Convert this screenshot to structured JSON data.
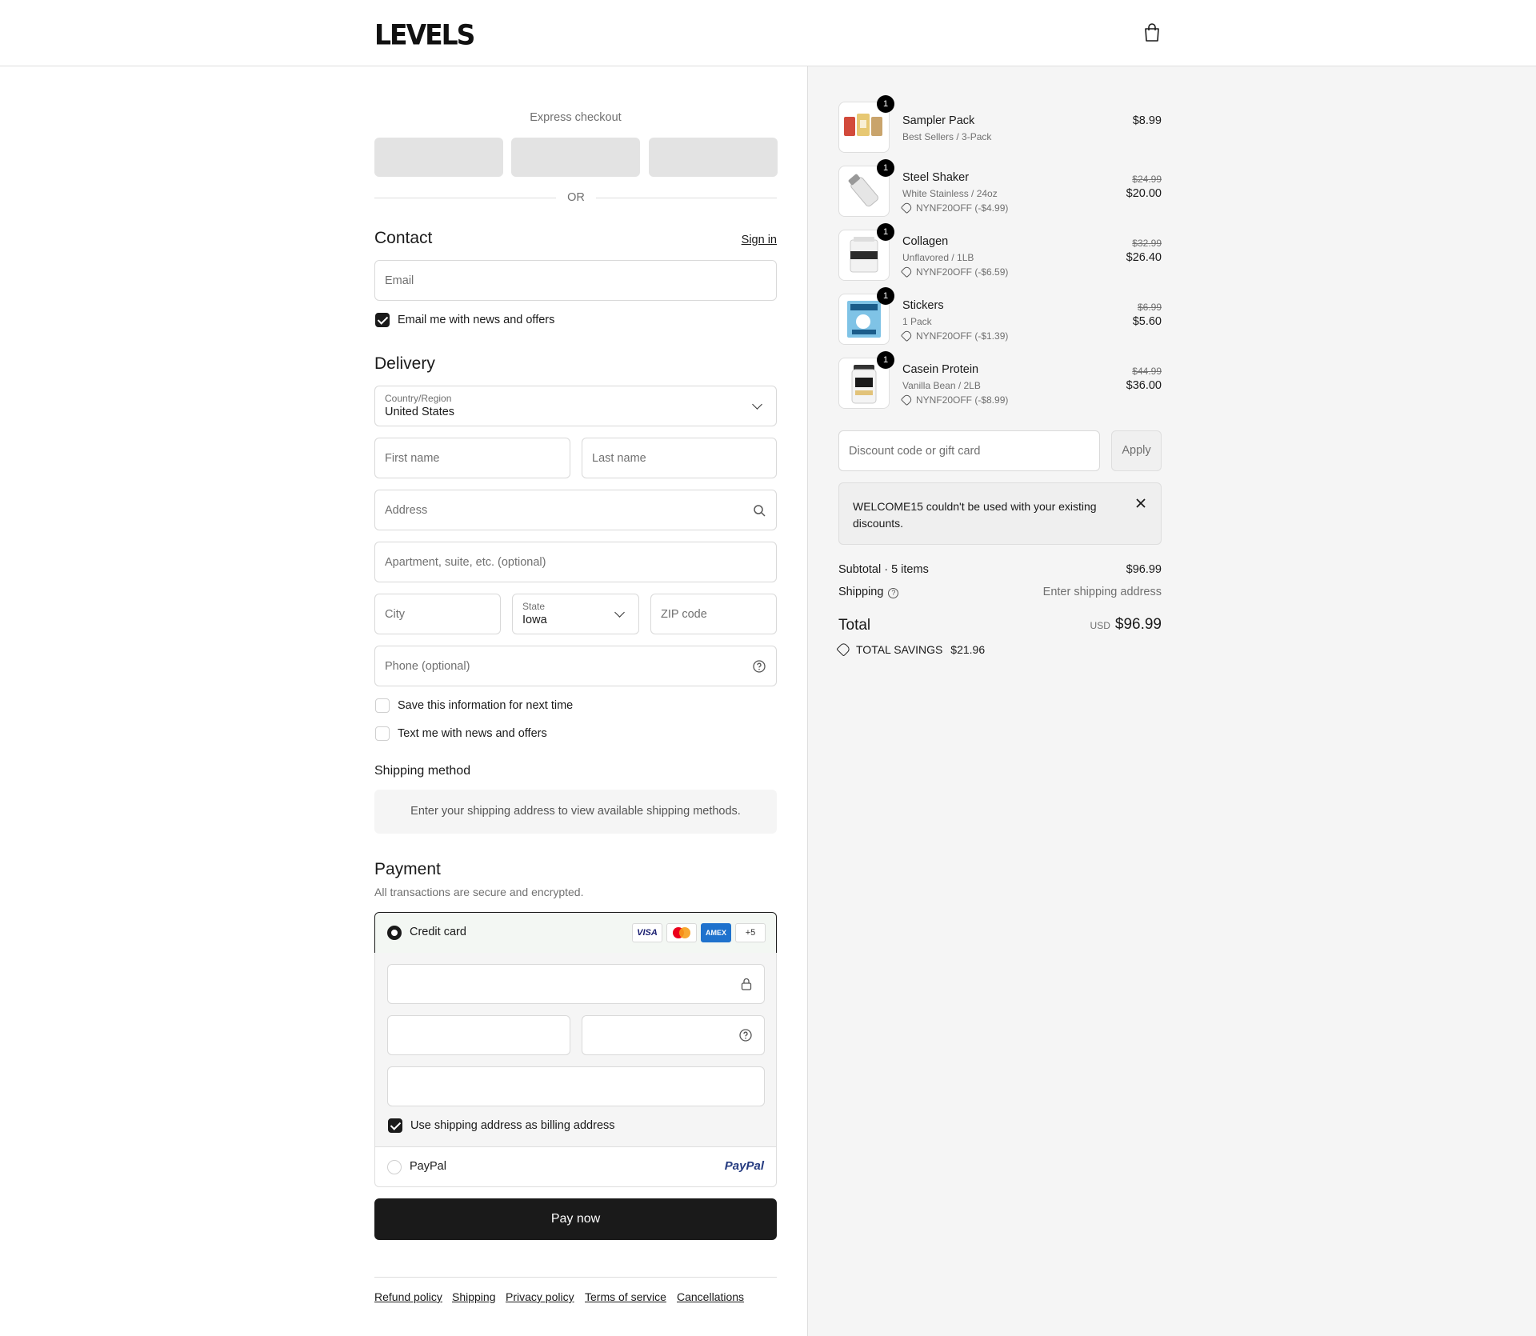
{
  "brand": {
    "logo_text": "LEVELS"
  },
  "express": {
    "label": "Express checkout",
    "or": "OR"
  },
  "contact": {
    "heading": "Contact",
    "sign_in": "Sign in",
    "email_placeholder": "Email",
    "news_label": "Email me with news and offers",
    "news_checked": true
  },
  "delivery": {
    "heading": "Delivery",
    "country_label": "Country/Region",
    "country_value": "United States",
    "first_name": "First name",
    "last_name": "Last name",
    "address": "Address",
    "apartment": "Apartment, suite, etc. (optional)",
    "city": "City",
    "state_label": "State",
    "state_value": "Iowa",
    "zip": "ZIP code",
    "phone": "Phone (optional)",
    "save_info": "Save this information for next time",
    "text_offers": "Text me with news and offers"
  },
  "shipping_method": {
    "heading": "Shipping method",
    "message": "Enter your shipping address to view available shipping methods."
  },
  "payment": {
    "heading": "Payment",
    "subtitle": "All transactions are secure and encrypted.",
    "credit_card": "Credit card",
    "brands": [
      "VISA",
      "MC",
      "AMEX",
      "+5"
    ],
    "billing_same": "Use shipping address as billing address",
    "paypal": "PayPal",
    "paypal_logo": "PayPal",
    "pay_now": "Pay now"
  },
  "footer": {
    "links": [
      "Refund policy",
      "Shipping",
      "Privacy policy",
      "Terms of service",
      "Cancellations"
    ]
  },
  "order": {
    "items": [
      {
        "name": "Sampler Pack",
        "variant": "Best Sellers / 3-Pack",
        "qty": "1",
        "price": "$8.99",
        "old_price": "",
        "code": ""
      },
      {
        "name": "Steel Shaker",
        "variant": "White Stainless / 24oz",
        "qty": "1",
        "price": "$20.00",
        "old_price": "$24.99",
        "code": "NYNF20OFF (-$4.99)"
      },
      {
        "name": "Collagen",
        "variant": "Unflavored / 1LB",
        "qty": "1",
        "price": "$26.40",
        "old_price": "$32.99",
        "code": "NYNF20OFF (-$6.59)"
      },
      {
        "name": "Stickers",
        "variant": "1 Pack",
        "qty": "1",
        "price": "$5.60",
        "old_price": "$6.99",
        "code": "NYNF20OFF (-$1.39)"
      },
      {
        "name": "Casein Protein",
        "variant": "Vanilla Bean / 2LB",
        "qty": "1",
        "price": "$36.00",
        "old_price": "$44.99",
        "code": "NYNF20OFF (-$8.99)"
      }
    ],
    "discount_placeholder": "Discount code or gift card",
    "apply": "Apply",
    "alert": "WELCOME15 couldn't be used with your existing discounts.",
    "subtotal_label": "Subtotal · 5 items",
    "subtotal": "$96.99",
    "shipping_label": "Shipping",
    "shipping_value": "Enter shipping address",
    "total_label": "Total",
    "currency": "USD",
    "total": "$96.99",
    "savings_label": "TOTAL SAVINGS",
    "savings": "$21.96"
  },
  "colors": {
    "primary": "#1a1a1a",
    "side_bg": "#f5f5f5",
    "border": "#d9d9d9",
    "muted": "#707070"
  }
}
